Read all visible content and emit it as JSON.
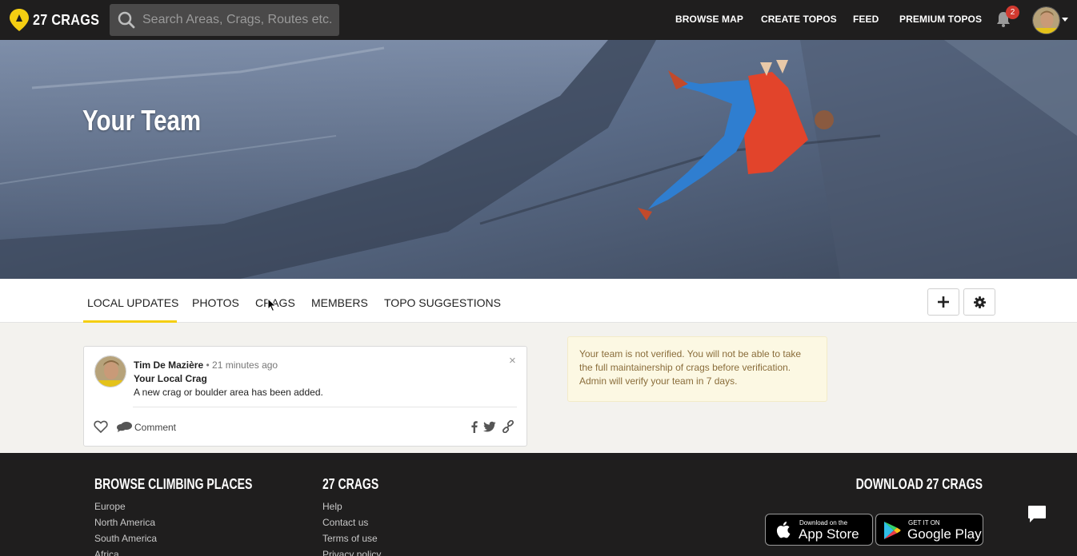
{
  "app": {
    "logo_text": "27 CRAGS"
  },
  "search": {
    "placeholder": "Search Areas, Crags, Routes etc."
  },
  "nav": {
    "items": [
      {
        "label": "BROWSE MAP"
      },
      {
        "label": "CREATE TOPOS"
      },
      {
        "label": "FEED"
      },
      {
        "label": "PREMIUM TOPOS"
      }
    ],
    "notifications_count": "2"
  },
  "hero": {
    "title": "Your Team"
  },
  "tabs": {
    "items": [
      {
        "label": "LOCAL UPDATES",
        "active": true
      },
      {
        "label": "PHOTOS"
      },
      {
        "label": "CRAGS"
      },
      {
        "label": "MEMBERS"
      },
      {
        "label": "TOPO SUGGESTIONS"
      }
    ],
    "add_icon": "plus-icon",
    "settings_icon": "gear-icon"
  },
  "feed": {
    "post": {
      "author": "Tim De Mazière",
      "time": "• 21 minutes ago",
      "title": "Your Local Crag",
      "text": "A new crag or boulder area has been added.",
      "close": "×",
      "comment_label": "Comment"
    }
  },
  "notice": {
    "text": "Your team is not verified. You will not be able to take the full maintainership of crags before verification. Admin will verify your team in 7 days."
  },
  "footer": {
    "col1": {
      "heading": "BROWSE CLIMBING PLACES",
      "links": [
        "Europe",
        "North America",
        "South America",
        "Africa"
      ]
    },
    "col2": {
      "heading": "27 CRAGS",
      "links": [
        "Help",
        "Contact us",
        "Terms of use",
        "Privacy policy"
      ]
    },
    "download": {
      "heading": "DOWNLOAD 27 CRAGS",
      "appstore_small": "Download on the",
      "appstore_big": "App Store",
      "googleplay_small": "GET IT ON",
      "googleplay_big": "Google Play"
    }
  },
  "colors": {
    "accent": "#f4ce12",
    "nav_bg": "#1f1e1e",
    "badge": "#d23a30"
  }
}
